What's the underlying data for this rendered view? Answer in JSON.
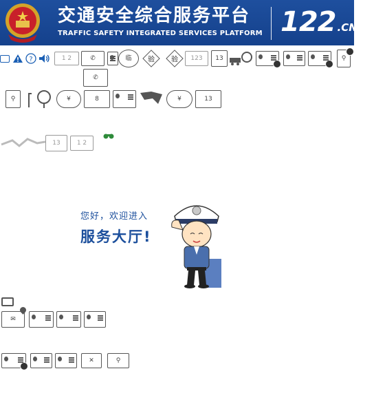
{
  "header": {
    "title_cn": "交通安全综合服务平台",
    "title_en": "TRAFFIC SAFETY INTEGRATED SERVICES PLATFORM",
    "brand_main": "122",
    "brand_suffix": ".CN"
  },
  "toolbar": {
    "num_icon_12": "1 2",
    "badge_lin": "临",
    "badge_yan": "验",
    "num_icon_123": "123",
    "num_icon_13": "13",
    "num_icon_8": "8",
    "yuan_symbol": "¥"
  },
  "welcome": {
    "greeting": "您好，欢迎进入",
    "hall": "服务大厅!"
  },
  "colors": {
    "header_bg": "#17458f",
    "welcome_text": "#1c4f9c",
    "icon_stroke": "#555555"
  }
}
